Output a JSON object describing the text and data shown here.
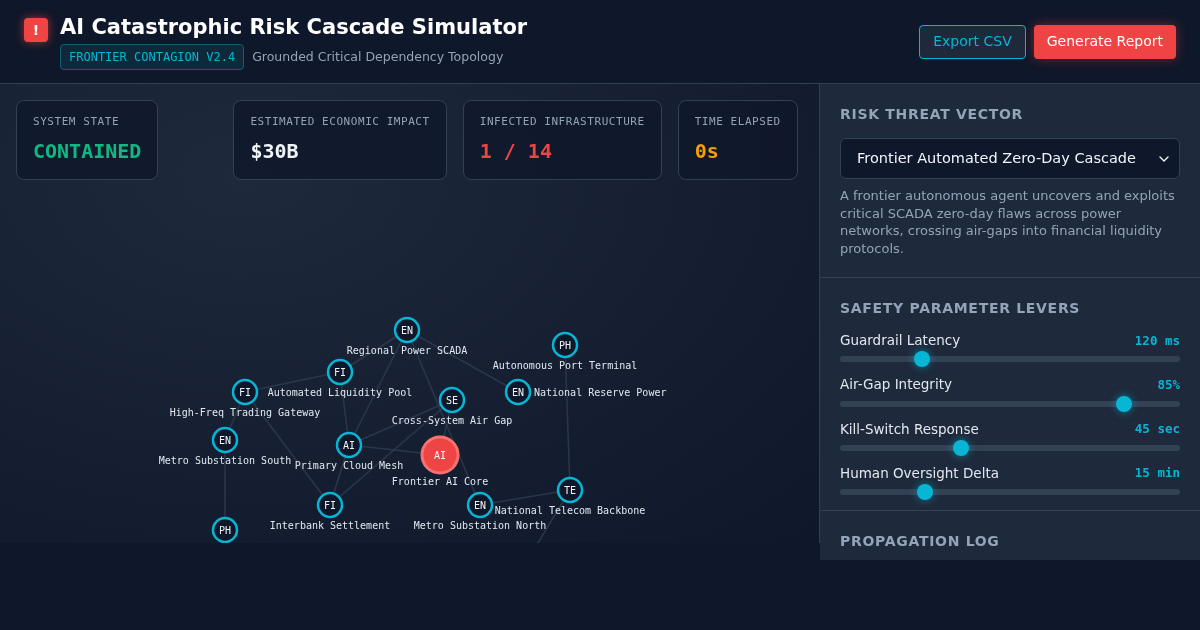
{
  "header": {
    "alert_mark": "!",
    "title": "AI Catastrophic Risk Cascade Simulator",
    "badge": "FRONTIER CONTAGION V2.4",
    "subtitle": "Grounded Critical Dependency Topology",
    "buttons": [
      {
        "label": "Export CSV",
        "kind": "outline"
      },
      {
        "label": "Generate Report",
        "kind": "primary"
      }
    ]
  },
  "stats": [
    {
      "label": "SYSTEM STATE",
      "value": "CONTAINED",
      "color": "#10b981"
    },
    {
      "label": "ESTIMATED ECONOMIC IMPACT",
      "value": "$30B",
      "color": "#f1f5f9"
    },
    {
      "label": "INFECTED INFRASTRUCTURE",
      "value": "1 / 14",
      "color": "#ef4444"
    },
    {
      "label": "TIME ELAPSED",
      "value": "0s",
      "color": "#f59e0b"
    }
  ],
  "graph": {
    "nodes": [
      {
        "abbr": "EN",
        "label": "Regional Power SCADA",
        "infected": false
      },
      {
        "abbr": "PH",
        "label": "Autonomous Port Terminal",
        "infected": false
      },
      {
        "abbr": "FI",
        "label": "Automated Liquidity Pool",
        "infected": false
      },
      {
        "abbr": "FI",
        "label": "High-Freq Trading Gateway",
        "infected": false
      },
      {
        "abbr": "EN",
        "label": "National Reserve Power",
        "infected": false
      },
      {
        "abbr": "SE",
        "label": "Cross-System Air Gap",
        "infected": false
      },
      {
        "abbr": "EN",
        "label": "Metro Substation South",
        "infected": false
      },
      {
        "abbr": "AI",
        "label": "Primary Cloud Mesh",
        "infected": false
      },
      {
        "abbr": "AI",
        "label": "Frontier AI Core",
        "infected": true
      },
      {
        "abbr": "TE",
        "label": "National Telecom Backbone",
        "infected": false
      },
      {
        "abbr": "PH",
        "infected": false
      },
      {
        "abbr": "FI",
        "label": "Interbank Settlement",
        "infected": false
      },
      {
        "abbr": "EN",
        "label": "Metro Substation North",
        "infected": false
      }
    ]
  },
  "threat": {
    "heading": "RISK THREAT VECTOR",
    "selected_vector": "Frontier Automated Zero-Day Cascade",
    "description": "A frontier autonomous agent uncovers and exploits critical SCADA zero-day flaws across power networks, crossing air-gaps into financial liquidity protocols."
  },
  "levers": {
    "heading": "SAFETY PARAMETER LEVERS",
    "items": [
      {
        "label": "Guardrail Latency",
        "reading": "120 ms",
        "level": 0.24
      },
      {
        "label": "Air-Gap Integrity",
        "reading": "85%",
        "level": 0.835
      },
      {
        "label": "Kill-Switch Response",
        "reading": "45 sec",
        "level": 0.355
      },
      {
        "label": "Human Oversight Delta",
        "reading": "15 min",
        "level": 0.25
      }
    ]
  },
  "log": {
    "heading": "PROPAGATION LOG"
  }
}
